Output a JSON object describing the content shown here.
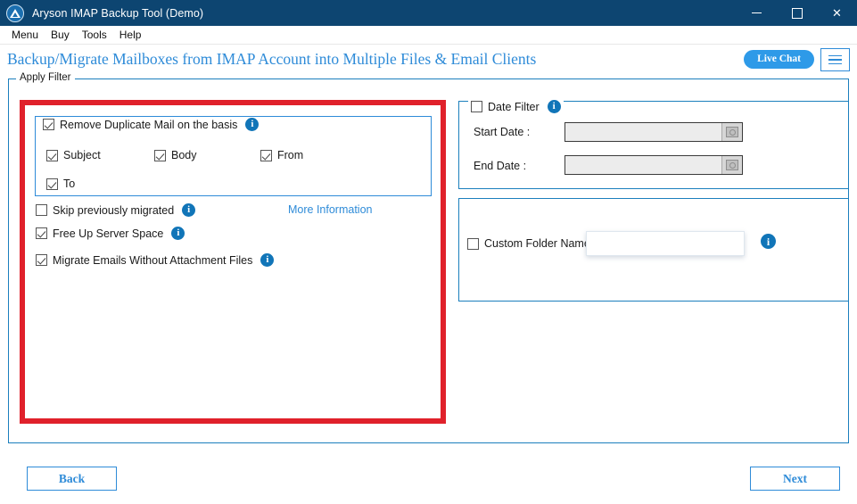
{
  "titlebar": {
    "title": "Aryson IMAP Backup Tool (Demo)",
    "logo_icon": "aryson-logo-icon",
    "minimize_icon": "minimize-icon",
    "maximize_icon": "maximize-icon",
    "close_icon": "close-icon",
    "close_glyph": "✕",
    "bg_color": "#0d4571"
  },
  "menubar": {
    "items": [
      {
        "label": "Menu"
      },
      {
        "label": "Buy"
      },
      {
        "label": "Tools"
      },
      {
        "label": "Help"
      }
    ]
  },
  "header": {
    "title": "Backup/Migrate Mailboxes from IMAP Account into Multiple Files & Email Clients",
    "title_color": "#2e8bd8",
    "live_chat_label": "Live Chat",
    "live_chat_color": "#2e9ae8",
    "hamburger_icon": "hamburger-menu-icon"
  },
  "apply_filter": {
    "legend": "Apply Filter"
  },
  "annotation": {
    "highlight_color": "#e0212b"
  },
  "left_panel": {
    "duplicate_group": {
      "main_checkbox": {
        "label": "Remove Duplicate Mail on the basis",
        "checked": true
      },
      "info_icon": "info-icon",
      "options": [
        {
          "label": "Subject",
          "checked": true
        },
        {
          "label": "Body",
          "checked": true
        },
        {
          "label": "From",
          "checked": true
        },
        {
          "label": "To",
          "checked": true
        }
      ]
    },
    "options": [
      {
        "label": "Skip previously migrated",
        "checked": false,
        "info_icon": "info-icon"
      },
      {
        "label": "Free Up Server Space",
        "checked": true,
        "info_icon": "info-icon"
      },
      {
        "label": "Migrate Emails Without Attachment Files",
        "checked": true,
        "info_icon": "info-icon"
      }
    ],
    "more_information_link": "More Information"
  },
  "date_filter": {
    "checkbox_label": "Date Filter",
    "checked": false,
    "info_icon": "info-icon",
    "start_label": "Start Date :",
    "start_value": "",
    "end_label": "End Date :",
    "end_value": "",
    "dropdown_icon": "calendar-dropdown-icon",
    "disabled": true
  },
  "custom_folder": {
    "checkbox_label": "Custom Folder Name",
    "checked": false,
    "input_value": "",
    "info_icon": "info-icon"
  },
  "footer": {
    "back_label": "Back",
    "next_label": "Next",
    "accent_color": "#2e8bd8"
  }
}
